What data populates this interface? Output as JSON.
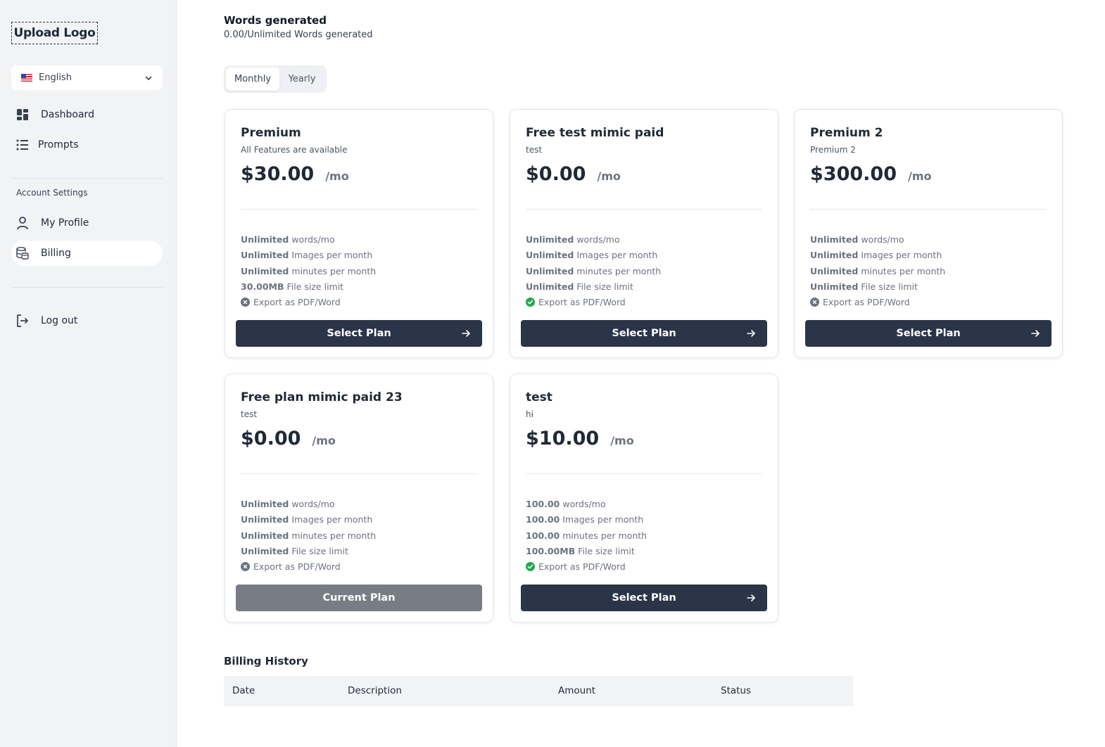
{
  "sidebar": {
    "logo": "Upload Logo",
    "language": "English",
    "nav": [
      {
        "label": "Dashboard"
      },
      {
        "label": "Prompts"
      }
    ],
    "account_settings_label": "Account Settings",
    "account": [
      {
        "label": "My Profile"
      },
      {
        "label": "Billing"
      }
    ],
    "logout": "Log out"
  },
  "usage": {
    "title": "Words generated",
    "subtitle": "0.00/Unlimited Words generated"
  },
  "billing_toggle": {
    "monthly": "Monthly",
    "yearly": "Yearly",
    "selected": "Monthly"
  },
  "plans": [
    {
      "name": "Premium",
      "description": "All Features are available",
      "price": "$30.00",
      "period": "/mo",
      "features": [
        {
          "value": "Unlimited",
          "text": " words/mo"
        },
        {
          "value": "Unlimited",
          "text": " Images per month"
        },
        {
          "value": "Unlimited",
          "text": " minutes per month"
        },
        {
          "value": "30.00MB",
          "text": " File size limit"
        }
      ],
      "export": "Export as PDF/Word",
      "export_enabled": false,
      "button": "Select Plan"
    },
    {
      "name": "Free test mimic paid",
      "description": "test",
      "price": "$0.00",
      "period": "/mo",
      "features": [
        {
          "value": "Unlimited",
          "text": " words/mo"
        },
        {
          "value": "Unlimited",
          "text": " Images per month"
        },
        {
          "value": "Unlimited",
          "text": " minutes per month"
        },
        {
          "value": "Unlimited",
          "text": " File size limit"
        }
      ],
      "export": "Export as PDF/Word",
      "export_enabled": true,
      "button": "Select Plan"
    },
    {
      "name": "Premium 2",
      "description": "Premium 2",
      "price": "$300.00",
      "period": "/mo",
      "features": [
        {
          "value": "Unlimited",
          "text": " words/mo"
        },
        {
          "value": "Unlimited",
          "text": " Images per month"
        },
        {
          "value": "Unlimited",
          "text": " minutes per month"
        },
        {
          "value": "Unlimited",
          "text": " File size limit"
        }
      ],
      "export": "Export as PDF/Word",
      "export_enabled": false,
      "button": "Select Plan"
    },
    {
      "name": "Free plan mimic paid 23",
      "description": "test",
      "price": "$0.00",
      "period": "/mo",
      "features": [
        {
          "value": "Unlimited",
          "text": " words/mo"
        },
        {
          "value": "Unlimited",
          "text": " Images per month"
        },
        {
          "value": "Unlimited",
          "text": " minutes per month"
        },
        {
          "value": "Unlimited",
          "text": " File size limit"
        }
      ],
      "export": "Export as PDF/Word",
      "export_enabled": false,
      "button": "Current Plan"
    },
    {
      "name": "test",
      "description": "hi",
      "price": "$10.00",
      "period": "/mo",
      "features": [
        {
          "value": "100.00",
          "text": " words/mo"
        },
        {
          "value": "100.00",
          "text": " Images per month"
        },
        {
          "value": "100.00",
          "text": " minutes per month"
        },
        {
          "value": "100.00MB",
          "text": " File size limit"
        }
      ],
      "export": "Export as PDF/Word",
      "export_enabled": true,
      "button": "Select Plan"
    }
  ],
  "billing_history": {
    "title": "Billing History",
    "columns": [
      "Date",
      "Description",
      "Amount",
      "Status"
    ]
  },
  "colors": {
    "primary_button": "#2b3548",
    "current_plan_button": "#787c85",
    "check_green": "#22a84a",
    "sidebar_bg": "#f2f3f5"
  }
}
